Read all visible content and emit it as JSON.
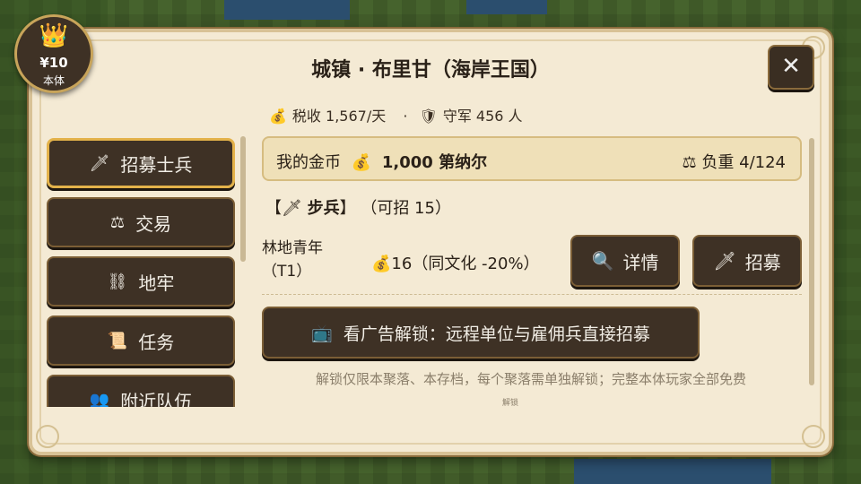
{
  "badge": {
    "icon": "crown-icon",
    "amount": "¥10",
    "sub": "本体"
  },
  "header": {
    "title": "城镇 · 布里甘（海岸王国）",
    "close_label": "✕"
  },
  "stats": {
    "tax_label": "税收 1,567/天",
    "separator": "·",
    "garrison_label": "守军 456 人"
  },
  "sidebar": {
    "items": [
      {
        "label": "招募士兵",
        "icon": "sword-icon",
        "glyph": "🗡",
        "active": true
      },
      {
        "label": "交易",
        "icon": "scales-icon",
        "glyph": "⚖",
        "active": false
      },
      {
        "label": "地牢",
        "icon": "shackles-icon",
        "glyph": "⛓",
        "active": false
      },
      {
        "label": "任务",
        "icon": "scroll-icon",
        "glyph": "📜",
        "active": false
      },
      {
        "label": "附近队伍",
        "icon": "people-icon",
        "glyph": "👥",
        "active": false
      }
    ]
  },
  "gold": {
    "label": "我的金币",
    "amount": "1,000 第纳尔",
    "load_label": "负重 4/124"
  },
  "section": {
    "prefix": "【",
    "name": "步兵",
    "suffix": "】",
    "available": "（可招 15）"
  },
  "unit": {
    "name": "林地青年",
    "tier": "（T1）",
    "cost": "16（同文化 -20%）",
    "details_label": "详情",
    "recruit_label": "招募"
  },
  "ad": {
    "label": "看广告解锁：远程单位与雇佣兵直接招募"
  },
  "note": {
    "text": "解锁仅限本聚落、本存档，每个聚落需单独解锁；完整本体玩家全部免费",
    "trailing": "解锁"
  },
  "colors": {
    "panel_bg": "#f4ead4",
    "button_bg": "#3e3125",
    "active_border": "#e3b24a",
    "gold_bar_bg": "#efe0b8"
  }
}
